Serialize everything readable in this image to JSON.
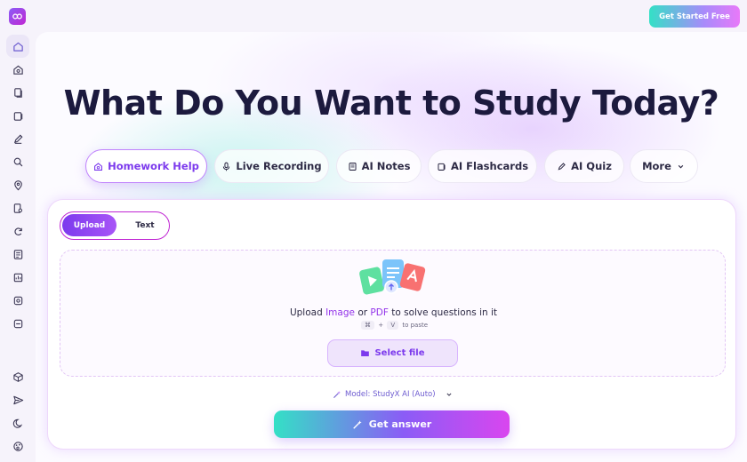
{
  "header": {
    "cta_label": "Get Started Free"
  },
  "sidebar": {
    "items": [
      {
        "icon": "home-icon",
        "active": true
      },
      {
        "icon": "camera-home-icon"
      },
      {
        "icon": "document-copy-icon"
      },
      {
        "icon": "flashcard-icon"
      },
      {
        "icon": "pen-edit-icon"
      },
      {
        "icon": "magic-search-icon"
      },
      {
        "icon": "map-pin-icon"
      },
      {
        "icon": "file-search-icon"
      },
      {
        "icon": "refresh-icon"
      },
      {
        "icon": "notes-icon"
      },
      {
        "icon": "presentation-icon"
      },
      {
        "icon": "quiz-icon"
      },
      {
        "icon": "more-box-icon"
      },
      {
        "icon": "box-3d-icon"
      },
      {
        "icon": "send-icon"
      },
      {
        "icon": "moon-icon"
      },
      {
        "icon": "palette-icon"
      }
    ]
  },
  "main": {
    "title": "What Do You Want to Study Today?",
    "tabs": [
      {
        "label": "Homework Help",
        "icon": "camera-home-icon",
        "active": true
      },
      {
        "label": "Live Recording",
        "icon": "microphone-icon"
      },
      {
        "label": "AI Notes",
        "icon": "notes-icon"
      },
      {
        "label": "AI Flashcards",
        "icon": "flashcard-icon"
      },
      {
        "label": "AI Quiz",
        "icon": "pen-edit-icon"
      },
      {
        "label": "More",
        "icon": "chevron-down-icon"
      }
    ]
  },
  "card": {
    "segment": {
      "upload": "Upload",
      "text": "Text",
      "selected": "Upload"
    },
    "dropzone": {
      "prefix": "Upload",
      "image": "Image",
      "or": "or",
      "pdf": "PDF",
      "suffix": "to solve questions in it",
      "key1": "⌘",
      "plus": "+",
      "key2": "V",
      "paste": "to paste",
      "select_label": "Select file"
    },
    "model_label": "Model: StudyX AI (Auto)",
    "submit_label": "Get answer"
  },
  "colors": {
    "accent": "#7c3aed",
    "highlight": "#9333ea",
    "teal": "#34e0c6",
    "pink": "#d946ef"
  }
}
